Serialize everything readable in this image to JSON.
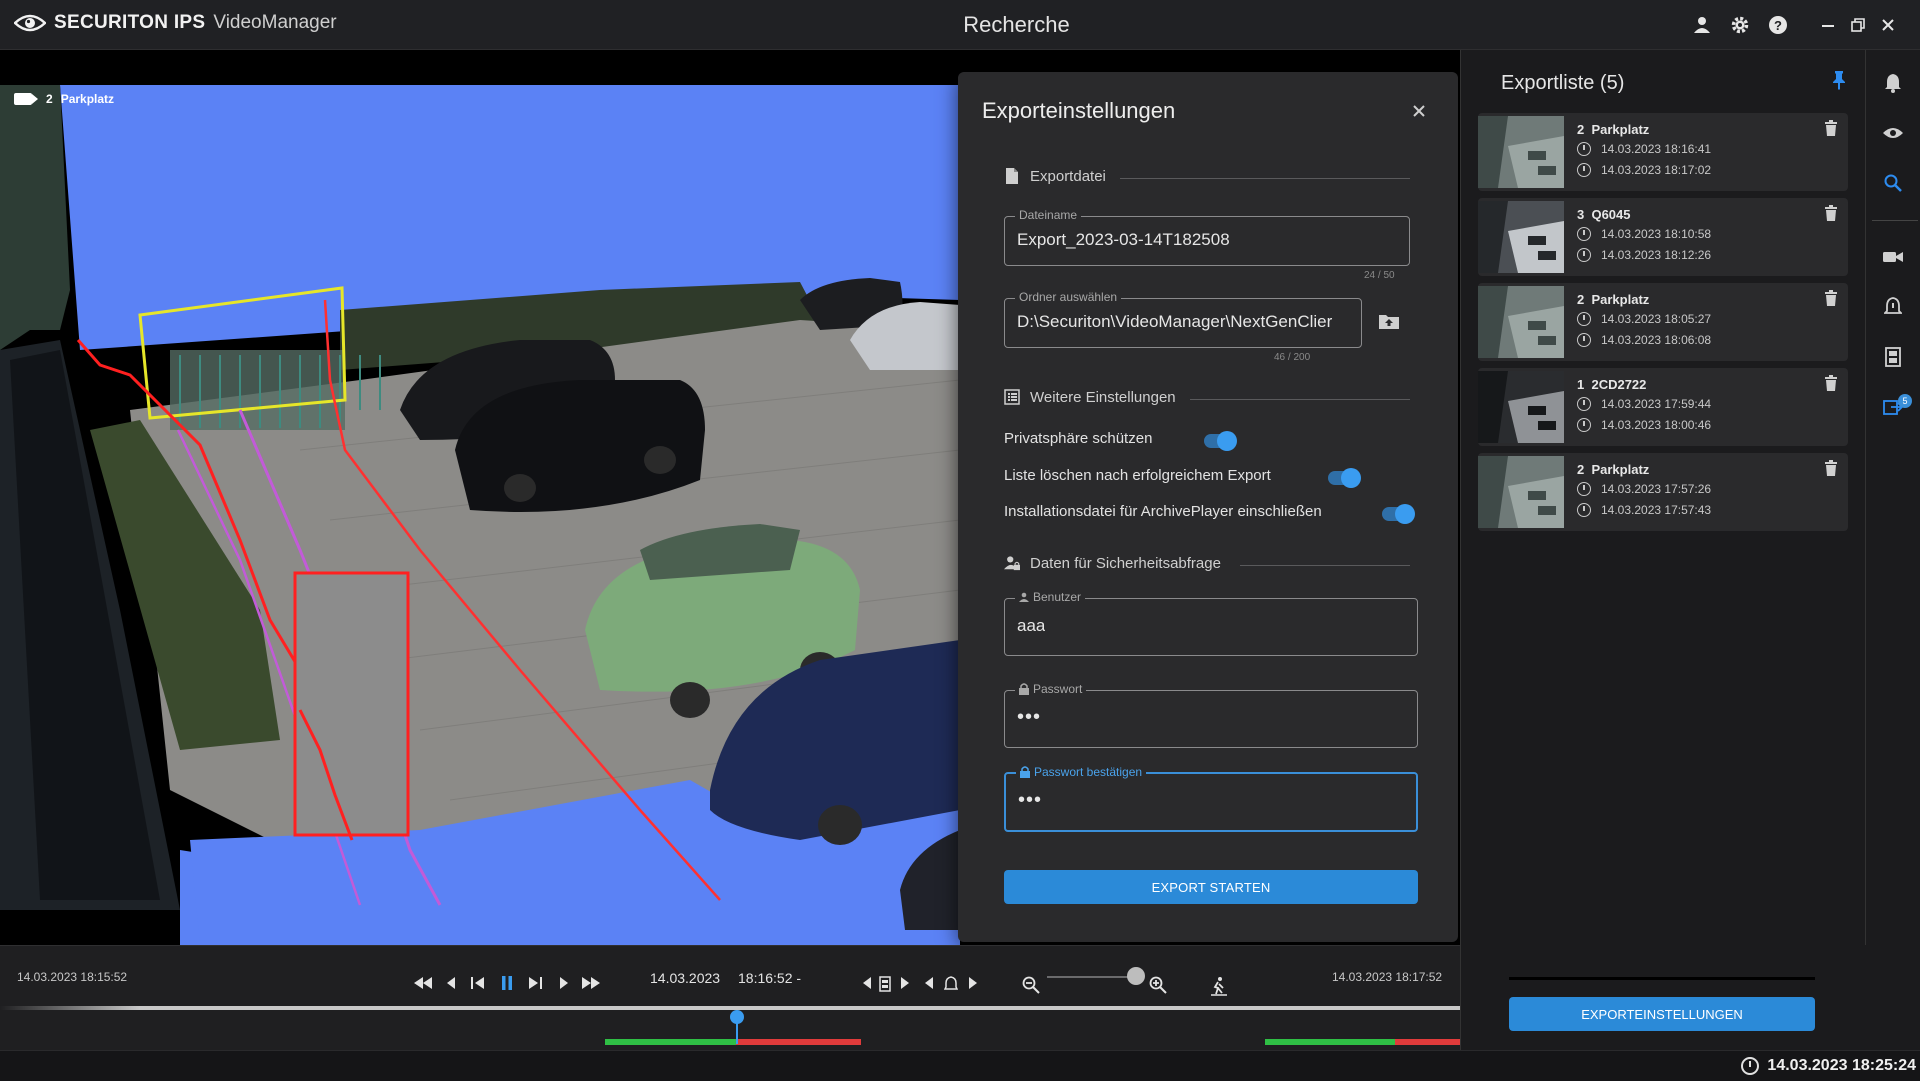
{
  "app": {
    "brand": "SECURITON IPS",
    "product": "VideoManager",
    "page_title": "Recherche"
  },
  "camera": {
    "number": "2",
    "name": "Parkplatz"
  },
  "modal": {
    "title": "Exporteinstellungen",
    "sections": {
      "exportfile": "Exportdatei",
      "more_settings": "Weitere Einstellungen",
      "security": "Daten für Sicherheitsabfrage"
    },
    "filename": {
      "label": "Dateiname",
      "value": "Export_2023-03-14T182508",
      "counter": "24 / 50"
    },
    "folder": {
      "label": "Ordner auswählen",
      "value": "D:\\Securiton\\VideoManager\\NextGenClier",
      "counter": "46 / 200"
    },
    "toggles": [
      {
        "label": "Privatsphäre schützen",
        "on": true
      },
      {
        "label": "Liste löschen nach erfolgreichem Export",
        "on": true
      },
      {
        "label": "Installationsdatei für ArchivePlayer einschließen",
        "on": true
      }
    ],
    "user": {
      "label": "Benutzer",
      "value": "aaa"
    },
    "password": {
      "label": "Passwort",
      "value": "•••"
    },
    "password_confirm": {
      "label": "Passwort bestätigen",
      "value": "•••"
    },
    "start_button": "EXPORT STARTEN"
  },
  "exportlist": {
    "title": "Exportliste (5)",
    "items": [
      {
        "number": "2",
        "name": "Parkplatz",
        "start": "14.03.2023 18:16:41",
        "end": "14.03.2023 18:17:02"
      },
      {
        "number": "3",
        "name": "Q6045",
        "start": "14.03.2023 18:10:58",
        "end": "14.03.2023 18:12:26"
      },
      {
        "number": "2",
        "name": "Parkplatz",
        "start": "14.03.2023 18:05:27",
        "end": "14.03.2023 18:06:08"
      },
      {
        "number": "1",
        "name": "2CD2722",
        "start": "14.03.2023 17:59:44",
        "end": "14.03.2023 18:00:46"
      },
      {
        "number": "2",
        "name": "Parkplatz",
        "start": "14.03.2023 17:57:26",
        "end": "14.03.2023 17:57:43"
      }
    ],
    "settings_button": "EXPORTEINSTELLUNGEN"
  },
  "timeline": {
    "start_time": "14.03.2023 18:15:52",
    "current_date": "14.03.2023",
    "current_time": "18:16:52 -",
    "end_time": "14.03.2023 18:17:52"
  },
  "status": {
    "datetime": "14.03.2023 18:25:24"
  },
  "rail": {
    "badge": "5"
  },
  "colors": {
    "accent": "#2b8ad8",
    "background": "#1b1b1d",
    "panel": "#2a2a2c",
    "video_mask": "#5b82f5"
  }
}
